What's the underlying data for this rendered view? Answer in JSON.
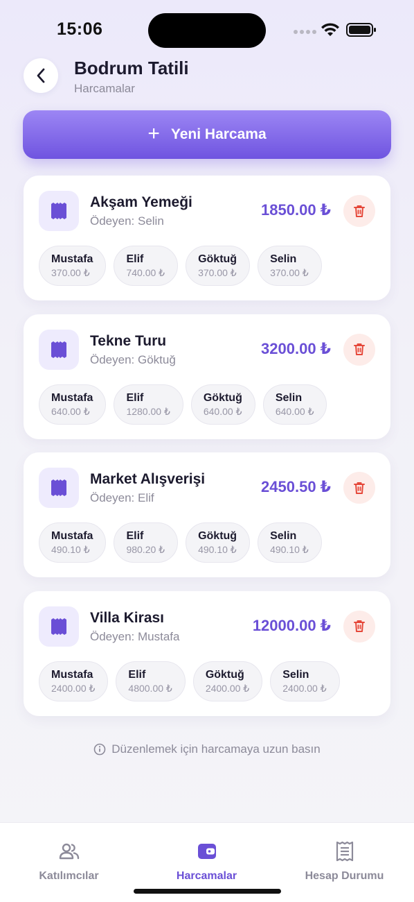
{
  "status": {
    "time": "15:06"
  },
  "header": {
    "title": "Bodrum Tatili",
    "subtitle": "Harcamalar"
  },
  "actions": {
    "new_expense_label": "Yeni Harcama"
  },
  "expenses": [
    {
      "title": "Akşam Yemeği",
      "payer": "Ödeyen: Selin",
      "amount": "1850.00 ₺",
      "shares": [
        {
          "name": "Mustafa",
          "amount": "370.00 ₺"
        },
        {
          "name": "Elif",
          "amount": "740.00 ₺"
        },
        {
          "name": "Göktuğ",
          "amount": "370.00 ₺"
        },
        {
          "name": "Selin",
          "amount": "370.00 ₺"
        }
      ]
    },
    {
      "title": "Tekne Turu",
      "payer": "Ödeyen: Göktuğ",
      "amount": "3200.00 ₺",
      "shares": [
        {
          "name": "Mustafa",
          "amount": "640.00 ₺"
        },
        {
          "name": "Elif",
          "amount": "1280.00 ₺"
        },
        {
          "name": "Göktuğ",
          "amount": "640.00 ₺"
        },
        {
          "name": "Selin",
          "amount": "640.00 ₺"
        }
      ]
    },
    {
      "title": "Market Alışverişi",
      "payer": "Ödeyen: Elif",
      "amount": "2450.50 ₺",
      "shares": [
        {
          "name": "Mustafa",
          "amount": "490.10 ₺"
        },
        {
          "name": "Elif",
          "amount": "980.20 ₺"
        },
        {
          "name": "Göktuğ",
          "amount": "490.10 ₺"
        },
        {
          "name": "Selin",
          "amount": "490.10 ₺"
        }
      ]
    },
    {
      "title": "Villa Kirası",
      "payer": "Ödeyen: Mustafa",
      "amount": "12000.00 ₺",
      "shares": [
        {
          "name": "Mustafa",
          "amount": "2400.00 ₺"
        },
        {
          "name": "Elif",
          "amount": "4800.00 ₺"
        },
        {
          "name": "Göktuğ",
          "amount": "2400.00 ₺"
        },
        {
          "name": "Selin",
          "amount": "2400.00 ₺"
        }
      ]
    }
  ],
  "hint": "Düzenlemek için harcamaya uzun basın",
  "tabs": [
    {
      "label": "Katılımcılar",
      "icon": "people-icon",
      "active": false
    },
    {
      "label": "Harcamalar",
      "icon": "wallet-icon",
      "active": true
    },
    {
      "label": "Hesap Durumu",
      "icon": "receipt-icon",
      "active": false
    }
  ],
  "colors": {
    "accent": "#6a4fd6",
    "danger": "#e5483a",
    "danger_bg": "#fdece9"
  }
}
